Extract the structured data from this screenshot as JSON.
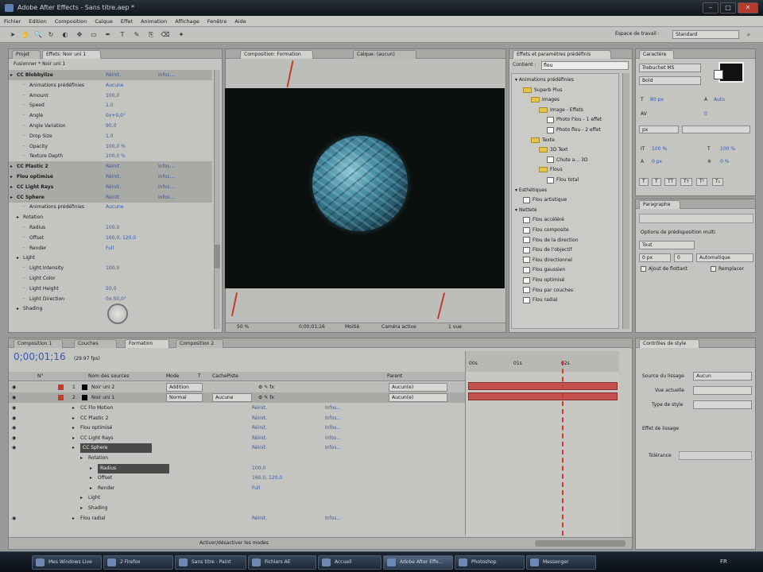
{
  "window": {
    "title": "Adobe After Effects - Sans titre.aep *"
  },
  "menu": [
    "Fichier",
    "Edition",
    "Composition",
    "Calque",
    "Effet",
    "Animation",
    "Affichage",
    "Fenêtre",
    "Aide"
  ],
  "toolbar": {
    "workspace_label": "Espace de travail :",
    "workspace_value": "Standard"
  },
  "effects_panel": {
    "tabs": [
      "Projet",
      "Effets: Noir uni 1"
    ],
    "header": "Fusionner * Noir uni 1",
    "rows": [
      {
        "name": "CC Blobbylize",
        "reset": "Réinit.",
        "about": "Infos..."
      },
      {
        "name": "Animations prédéfinies",
        "value": "Aucune"
      },
      {
        "name": "Amount",
        "value": "100,0"
      },
      {
        "name": "Speed",
        "value": "1,0"
      },
      {
        "name": "Angle",
        "value": "0x+0,0°"
      },
      {
        "name": "Angle Variation",
        "value": "90,0"
      },
      {
        "name": "Drop Size",
        "value": "1,0"
      },
      {
        "name": "Opacity",
        "value": "100,0 %"
      },
      {
        "name": "Texture Depth",
        "value": "100,0 %"
      },
      {
        "name": "CC Plastic 2",
        "reset": "Réinit.",
        "about": "Infos..."
      },
      {
        "name": "Flou optimisé",
        "reset": "Réinit.",
        "about": "Infos..."
      },
      {
        "name": "CC Light Rays",
        "reset": "Réinit.",
        "about": "Infos..."
      },
      {
        "name": "CC Sphere",
        "reset": "Réinit.",
        "about": "Infos..."
      },
      {
        "name": "Animations prédéfinies",
        "value": "Aucune"
      },
      {
        "name": "Rotation",
        "value": ""
      },
      {
        "name": "Radius",
        "value": "100,0"
      },
      {
        "name": "Offset",
        "value": "160,0, 120,0"
      },
      {
        "name": "Render",
        "value": "Full"
      },
      {
        "name": "Light",
        "value": ""
      },
      {
        "name": "Light Intensity",
        "value": "100,0"
      },
      {
        "name": "Light Color",
        "value": ""
      },
      {
        "name": "Light Height",
        "value": "50,0"
      },
      {
        "name": "Light Direction",
        "value": "0x-50,0°"
      },
      {
        "name": "Shading",
        "value": ""
      }
    ]
  },
  "composition_panel": {
    "tabs": [
      "Composition: Formation",
      "Calque: (aucun)"
    ],
    "zoom": "50 %",
    "timecode": "0;00;01;16",
    "resolution": "Moitié",
    "view": "Caméra active",
    "views": "1 vue"
  },
  "presets_panel": {
    "tabs": [
      "Effets et paramètres prédéfinis"
    ],
    "search_label": "Contient :",
    "search_value": "flou",
    "items": [
      {
        "label": "Animations prédéfinies",
        "indent": 0,
        "type": "arrow"
      },
      {
        "label": "Superb Plus",
        "indent": 1,
        "type": "folder"
      },
      {
        "label": "Images",
        "indent": 2,
        "type": "folder"
      },
      {
        "label": "Image - Effets",
        "indent": 3,
        "type": "folder"
      },
      {
        "label": "Photo Flou - 1 effet",
        "indent": 4,
        "type": "effect"
      },
      {
        "label": "Photo flou - 2 effet",
        "indent": 4,
        "type": "effect"
      },
      {
        "label": "Texte",
        "indent": 2,
        "type": "folder"
      },
      {
        "label": "3D Text",
        "indent": 3,
        "type": "folder"
      },
      {
        "label": "Chute a... 3D",
        "indent": 4,
        "type": "effect"
      },
      {
        "label": "Flous",
        "indent": 3,
        "type": "folder"
      },
      {
        "label": "Flou total",
        "indent": 4,
        "type": "effect"
      },
      {
        "label": "Esthétiques",
        "indent": 0,
        "type": "arrow"
      },
      {
        "label": "Flou artistique",
        "indent": 1,
        "type": "effect"
      },
      {
        "label": "Netteté",
        "indent": 0,
        "type": "arrow"
      },
      {
        "label": "Flou accéléré",
        "indent": 1,
        "type": "effect"
      },
      {
        "label": "Flou composite",
        "indent": 1,
        "type": "effect"
      },
      {
        "label": "Flou de la direction",
        "indent": 1,
        "type": "effect"
      },
      {
        "label": "Flou de l'objectif",
        "indent": 1,
        "type": "effect"
      },
      {
        "label": "Flou directionnel",
        "indent": 1,
        "type": "effect"
      },
      {
        "label": "Flou gaussien",
        "indent": 1,
        "type": "effect"
      },
      {
        "label": "Flou optimisé",
        "indent": 1,
        "type": "effect"
      },
      {
        "label": "Flou par couches",
        "indent": 1,
        "type": "effect"
      },
      {
        "label": "Flou radial",
        "indent": 1,
        "type": "effect"
      }
    ]
  },
  "character_panel": {
    "tabs": [
      "Caractère"
    ],
    "font": "Trebuchet MS",
    "style": "Bold",
    "size": "80 px",
    "leading": "Auto",
    "tracking": "0",
    "scale_v": "100 %",
    "scale_h": "100 %",
    "baseline": "0 px",
    "tsume": "0 %"
  },
  "paragraph_panel": {
    "tabs": [
      "Paragraphe"
    ],
    "option_label": "Options de prédisposition multi",
    "align_value": "Tout",
    "field1": "0 px",
    "field2": "0",
    "field3": "Automatique",
    "check1": "Ajout de flottant",
    "check2": "Remplacer"
  },
  "timeline": {
    "tabs": [
      "Composition 1",
      "Couches",
      "Formation",
      "Composition 2"
    ],
    "timecode": "0;00;01;16",
    "fps": "(29.97 fps)",
    "columns": [
      "N°",
      "Nom des sources",
      "Mode",
      "T",
      "CachePiste",
      "Parent"
    ],
    "ruler": [
      "00s",
      "01s",
      "02s"
    ],
    "layers": [
      {
        "num": "1",
        "name": "Noir uni 2",
        "mode": "Addition",
        "parent": "Aucun(e)"
      },
      {
        "num": "2",
        "name": "Noir uni 1",
        "mode": "Normal",
        "track": "Aucune",
        "parent": "Aucun(e)"
      }
    ],
    "sub_rows": [
      {
        "name": "CC Flo Motion",
        "reset": "Réinit.",
        "about": "Infos..."
      },
      {
        "name": "CC Plastic 2",
        "reset": "Réinit.",
        "about": "Infos..."
      },
      {
        "name": "Flou optimisé",
        "reset": "Réinit.",
        "about": "Infos..."
      },
      {
        "name": "CC Light Rays",
        "reset": "Réinit.",
        "about": "Infos..."
      },
      {
        "name": "CC Sphere",
        "reset": "Réinit.",
        "about": "Infos..."
      },
      {
        "name": "Rotation",
        "value": ""
      },
      {
        "name": "Radius",
        "value": "100,0"
      },
      {
        "name": "Offset",
        "value": "160,0, 120,0"
      },
      {
        "name": "Render",
        "value": "Full"
      },
      {
        "name": "Light",
        "value": ""
      },
      {
        "name": "Shading",
        "value": ""
      },
      {
        "name": "Flou radial",
        "reset": "Réinit.",
        "about": "Infos..."
      }
    ],
    "footer": "Activer/désactiver les modes"
  },
  "smoother_panel": {
    "tabs": [
      "Contrôles de style"
    ],
    "label1": "Source du lissage",
    "value1": "Aucun",
    "label2": "Vue actuelle",
    "label3": "Type de style",
    "label4": "Effet de lissage",
    "label5": "Tolérance"
  },
  "taskbar": [
    "Mes Windows Live",
    "2 Firefox",
    "Sans titre - Paint",
    "Fichiers AE",
    "Accueil",
    "Adobe After Effe...",
    "Photoshop",
    "Messenger",
    "FR"
  ]
}
